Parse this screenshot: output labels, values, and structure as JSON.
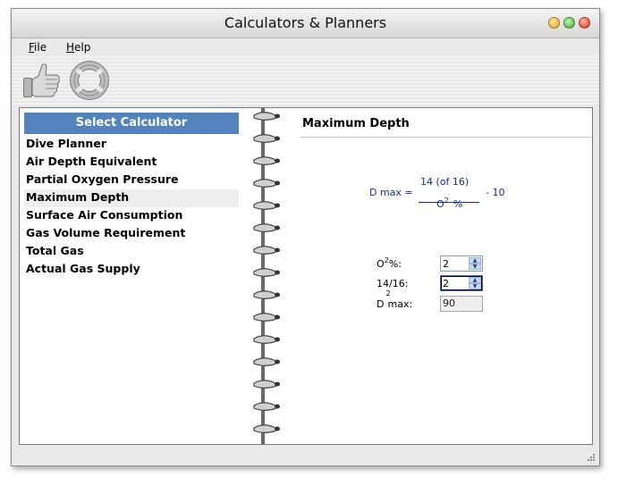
{
  "window": {
    "title": "Calculators & Planners"
  },
  "menu": [
    {
      "label": "File",
      "key": "F"
    },
    {
      "label": "Help",
      "key": "H"
    }
  ],
  "toolbar": {
    "icons": [
      "thumbs-up-icon",
      "lifebuoy-icon"
    ]
  },
  "sidebar": {
    "header": "Select Calculator",
    "items": [
      "Dive Planner",
      "Air Depth Equivalent",
      "Partial Oxygen Pressure",
      "Maximum Depth",
      "Surface Air Consumption",
      "Gas Volume Requirement",
      "Total Gas",
      "Actual Gas Supply"
    ],
    "selected_index": 3
  },
  "calculator": {
    "title": "Maximum Depth",
    "formula": {
      "lhs": "D max =",
      "numerator": "14 (of 16)",
      "denominator_base": "O",
      "denominator_sup": "2",
      "denominator_unit": "%",
      "suffix": "- 10"
    },
    "fields": {
      "o2_label_base": "O",
      "o2_label_sup": "2",
      "o2_label_rest": "%:",
      "o2_value": "2",
      "depth_label": "14/16:",
      "depth_value": "2",
      "dmax_label_base": "D",
      "dmax_label_sup": "2",
      "dmax_label_rest": "max:",
      "dmax_value": "90"
    }
  },
  "colors": {
    "sidebar_header": "#5283bd",
    "formula_text": "#1a2d8a",
    "selected_row": "#eeeeee"
  }
}
